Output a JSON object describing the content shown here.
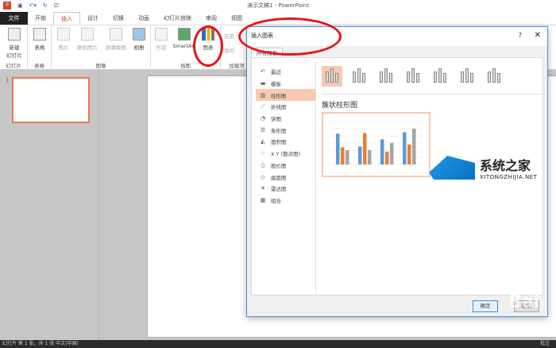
{
  "app": {
    "title": "演示文稿1 - PowerPoint",
    "logo": "P"
  },
  "tabs": [
    "文件",
    "开始",
    "插入",
    "设计",
    "切换",
    "动画",
    "幻灯片放映",
    "审阅",
    "视图"
  ],
  "active_tab": "插入",
  "ribbon": {
    "groups": [
      {
        "label": "幻灯片",
        "buttons": [
          "新建\n幻灯片"
        ]
      },
      {
        "label": "表格",
        "buttons": [
          "表格"
        ]
      },
      {
        "label": "图像",
        "buttons": [
          "图片",
          "联机图片",
          "屏幕截图",
          "相册"
        ]
      },
      {
        "label": "插图",
        "buttons": [
          "形状",
          "SmartArt",
          "图表"
        ]
      },
      {
        "label": "加载项",
        "buttons": [
          "应用",
          "我的"
        ]
      }
    ]
  },
  "slides": {
    "number": "1"
  },
  "status": {
    "left": "幻灯片 第 1 张，共 1 张    中文(中国)",
    "right": "批注"
  },
  "dialog": {
    "title": "插入图表",
    "help": "?",
    "close": "✕",
    "tab": "所有图表",
    "categories": [
      {
        "icon": "↶",
        "label": "最近"
      },
      {
        "icon": "▬",
        "label": "模板"
      },
      {
        "icon": "▥",
        "label": "柱形图"
      },
      {
        "icon": "⟋",
        "label": "折线图"
      },
      {
        "icon": "◔",
        "label": "饼图"
      },
      {
        "icon": "☰",
        "label": "条形图"
      },
      {
        "icon": "◭",
        "label": "面积图"
      },
      {
        "icon": "⁘",
        "label": "X Y (散点图)"
      },
      {
        "icon": "▯",
        "label": "股价图"
      },
      {
        "icon": "◇",
        "label": "曲面图"
      },
      {
        "icon": "✶",
        "label": "雷达图"
      },
      {
        "icon": "▦",
        "label": "组合"
      }
    ],
    "selected_category": "柱形图",
    "subtype_title": "簇状柱形图",
    "ok": "确定",
    "cancel": "取消",
    "preview": {
      "colors": [
        "#5b9bd5",
        "#ed7d31",
        "#a5a5a5"
      ],
      "series": [
        [
          4.3,
          2.5,
          3.5,
          4.5
        ],
        [
          2.4,
          4.4,
          1.8,
          2.8
        ],
        [
          2,
          2,
          3,
          5
        ]
      ]
    }
  },
  "watermark": {
    "name": "系统之家",
    "url": "XITONGZHIJIA.NET",
    "baidu": "Bai"
  },
  "highlight_color": "#e8141b"
}
